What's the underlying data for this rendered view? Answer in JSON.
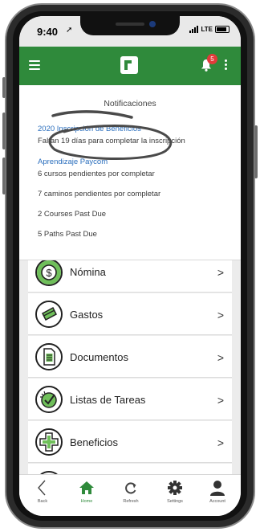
{
  "status_bar": {
    "time": "9:40",
    "network": "LTE",
    "battery_level": 0.85
  },
  "header": {
    "menu_icon": "hamburger-icon",
    "logo_icon": "paycom-logo",
    "notifications_icon": "bell-icon",
    "notification_count": "5",
    "more_icon": "kebab-menu-icon",
    "brand_color": "#2f8a3b"
  },
  "notifications": {
    "title": "Notificaciones",
    "items": [
      {
        "heading": "2020 Inscripción de Beneficios",
        "detail": "Faltan 19 días para completar la inscripción"
      },
      {
        "heading": "Aprendizaje Paycom",
        "detail": "6 cursos pendientes por completar"
      },
      {
        "detail": "7 caminos pendientes por completar"
      },
      {
        "detail": "2 Courses Past Due"
      },
      {
        "detail": "5 Paths Past Due"
      }
    ],
    "link_color": "#2a6ebd"
  },
  "menu": {
    "items": [
      {
        "label": "Nómina",
        "icon": "dollar-coin-icon"
      },
      {
        "label": "Gastos",
        "icon": "credit-card-icon"
      },
      {
        "label": "Documentos",
        "icon": "document-icon"
      },
      {
        "label": "Listas de Tareas",
        "icon": "checklist-icon"
      },
      {
        "label": "Beneficios",
        "icon": "medical-cross-icon"
      }
    ],
    "chevron": ">"
  },
  "tabs": [
    {
      "label": "Back",
      "icon": "back-chevron-icon"
    },
    {
      "label": "Home",
      "icon": "home-icon",
      "active": true
    },
    {
      "label": "Refresh",
      "icon": "refresh-icon"
    },
    {
      "label": "Settings",
      "icon": "gear-icon"
    },
    {
      "label": "Account",
      "icon": "account-icon"
    }
  ]
}
